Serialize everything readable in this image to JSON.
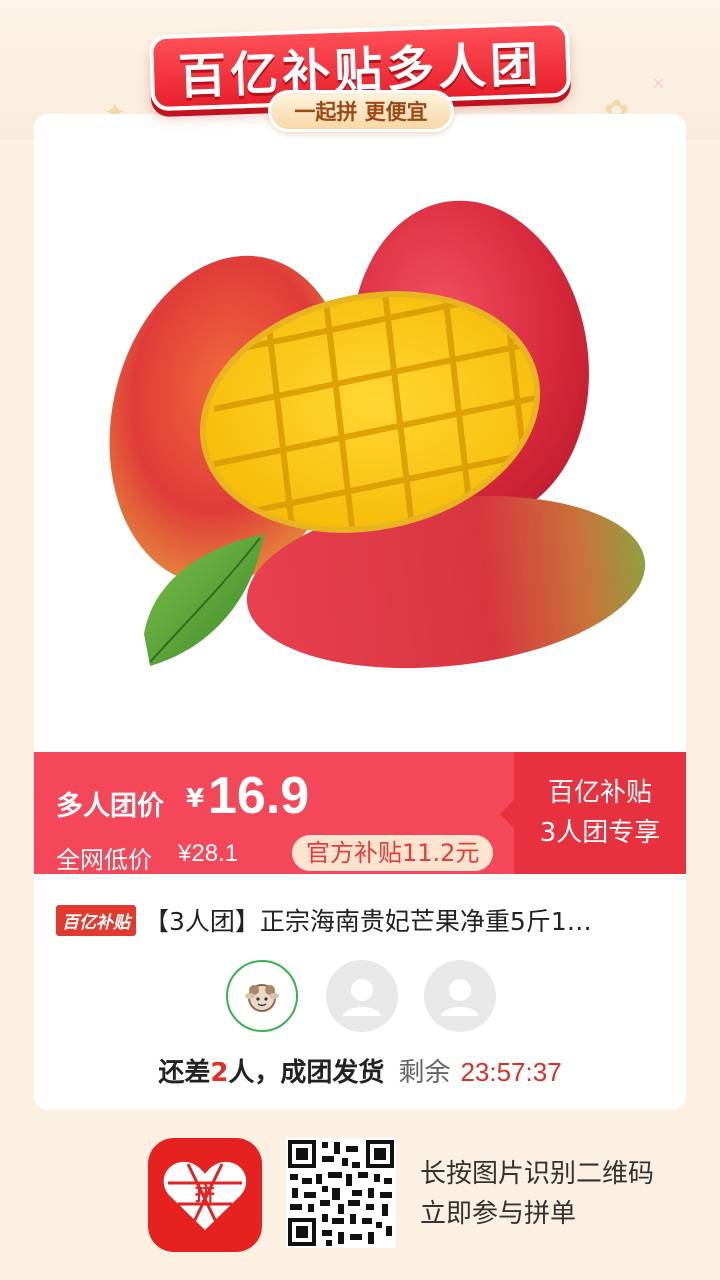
{
  "banner": {
    "title": "百亿补贴多人团",
    "subtitle": "一起拼 更便宜"
  },
  "price": {
    "group_label": "多人团价",
    "currency": "¥",
    "value": "16.9",
    "market_label": "全网低价",
    "market_price": "¥28.1",
    "subsidy": "官方补贴11.2元",
    "side_line1": "百亿补贴",
    "side_line2": "3人团专享"
  },
  "product": {
    "brand_tag": "百亿补贴",
    "title": "【3人团】正宗海南贵妃芒果净重5斤1…"
  },
  "status": {
    "prefix": "还差",
    "need": "2",
    "suffix": "人，成团发货",
    "remain_label": "剩余",
    "countdown": "23:57:37"
  },
  "footer": {
    "line1": "长按图片识别二维码",
    "line2": "立即参与拼单",
    "logo_char": "拼"
  },
  "colors": {
    "accent": "#f4485a",
    "accent_dark": "#e8313f",
    "brand_red": "#e02e24",
    "member_ring": "#37b24d"
  },
  "icons": {
    "sparkle": "sparkle-icon",
    "user_placeholder": "user-placeholder-icon",
    "mango": "mango-product-image",
    "app": "pinduoduo-logo"
  }
}
